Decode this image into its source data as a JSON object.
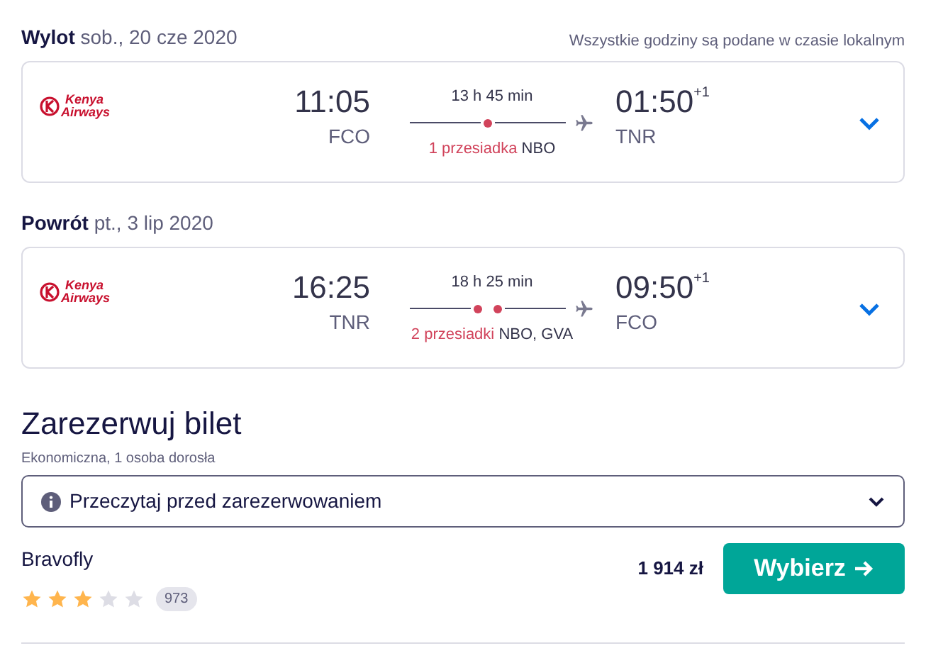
{
  "note": "Wszystkie godziny są podane w czasie lokalnym",
  "flights": [
    {
      "label": "Wylot",
      "date": "sob., 20 cze 2020",
      "airline": {
        "line1": "Kenya",
        "line2": "Airways"
      },
      "depart_time": "11:05",
      "depart_code": "FCO",
      "duration": "13 h 45 min",
      "stop_markers": [
        {
          "kind": "stop"
        }
      ],
      "stops_label": "1 przesiadka",
      "stops_codes": "NBO",
      "arrive_time": "01:50",
      "day_offset": "+1",
      "arrive_code": "TNR",
      "expanded": false
    },
    {
      "label": "Powrót",
      "date": "pt., 3 lip 2020",
      "airline": {
        "line1": "Kenya",
        "line2": "Airways"
      },
      "depart_time": "16:25",
      "depart_code": "TNR",
      "duration": "18 h 25 min",
      "stop_markers": [
        {
          "kind": "stop"
        },
        {
          "kind": "stop"
        }
      ],
      "stops_label": "2 przesiadki",
      "stops_codes": "NBO, GVA",
      "arrive_time": "09:50",
      "day_offset": "+1",
      "arrive_code": "FCO",
      "expanded": false
    }
  ],
  "booking": {
    "title": "Zarezerwuj bilet",
    "subtitle": "Ekonomiczna, 1 osoba dorosła",
    "info": {
      "label": "Przeczytaj przed zarezerwowaniem",
      "expanded": false
    },
    "provider": {
      "name": "Bravofly",
      "stars": 3,
      "reviews": "973",
      "price": "1 914 zł",
      "button": "Wybierz"
    }
  }
}
